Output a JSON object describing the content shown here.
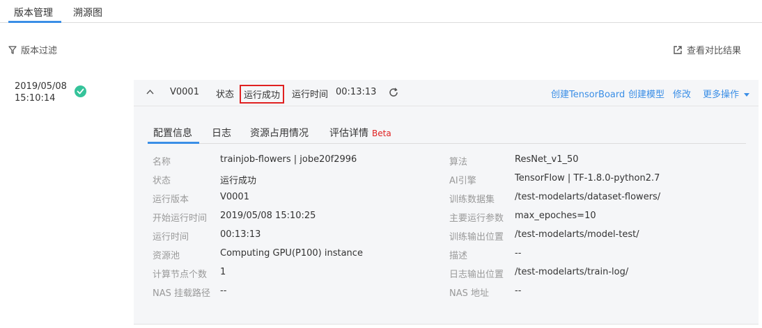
{
  "top_tabs": [
    "版本管理",
    "溯源图"
  ],
  "toolbar": {
    "filter_label": "版本过滤",
    "compare_label": "查看对比结果"
  },
  "version": {
    "date": "2019/05/08",
    "time": "15:10:14",
    "name": "V0001",
    "status_label": "状态",
    "status_value": "运行成功",
    "runtime_label": "运行时间",
    "runtime_value": "00:13:13",
    "status_color": "#35c39a"
  },
  "actions": [
    "创建TensorBoard",
    "创建模型",
    "修改",
    "更多操作"
  ],
  "inner_tabs": {
    "items": [
      "配置信息",
      "日志",
      "资源占用情况",
      "评估详情"
    ],
    "beta": "Beta"
  },
  "details_left": [
    {
      "label": "名称",
      "value": "trainjob-flowers | jobe20f2996"
    },
    {
      "label": "状态",
      "value": "运行成功"
    },
    {
      "label": "运行版本",
      "value": "V0001"
    },
    {
      "label": "开始运行时间",
      "value": "2019/05/08 15:10:25"
    },
    {
      "label": "运行时间",
      "value": "00:13:13"
    },
    {
      "label": "资源池",
      "value": "Computing GPU(P100) instance"
    },
    {
      "label": "计算节点个数",
      "value": "1"
    },
    {
      "label": "NAS 挂载路径",
      "value": "--"
    }
  ],
  "details_right": [
    {
      "label": "算法",
      "value": "ResNet_v1_50"
    },
    {
      "label": "AI引擎",
      "value": "TensorFlow | TF-1.8.0-python2.7"
    },
    {
      "label": "训练数据集",
      "value": "/test-modelarts/dataset-flowers/"
    },
    {
      "label": "主要运行参数",
      "value": "max_epoches=10"
    },
    {
      "label": "训练输出位置",
      "value": "/test-modelarts/model-test/"
    },
    {
      "label": "描述",
      "value": "--"
    },
    {
      "label": "日志输出位置",
      "value": "/test-modelarts/train-log/"
    },
    {
      "label": "NAS 地址",
      "value": "--"
    }
  ],
  "colors": {
    "accent": "#3a8ee6",
    "highlight_box": "#e02020"
  }
}
